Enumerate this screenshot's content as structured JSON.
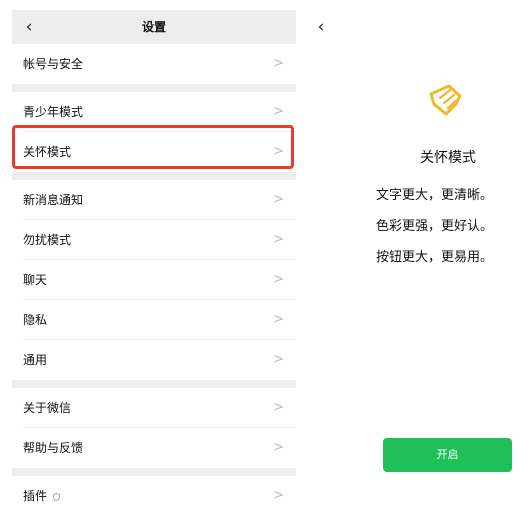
{
  "left": {
    "title": "设置",
    "rows": [
      {
        "label": "帐号与安全",
        "chevron": ">"
      },
      {
        "label": "青少年模式",
        "chevron": ">"
      },
      {
        "label": "关怀模式",
        "chevron": ">"
      },
      {
        "label": "新消息通知",
        "chevron": ">"
      },
      {
        "label": "勿扰模式",
        "chevron": ">"
      },
      {
        "label": "聊天",
        "chevron": ">"
      },
      {
        "label": "隐私",
        "chevron": ">"
      },
      {
        "label": "通用",
        "chevron": ">"
      },
      {
        "label": "关于微信",
        "chevron": ">"
      },
      {
        "label": "帮助与反馈",
        "chevron": ">"
      },
      {
        "label": "插件",
        "chevron": ">"
      }
    ]
  },
  "right": {
    "title": "关怀模式",
    "lines": [
      "文字更大，更清晰。",
      "色彩更强，更好认。",
      "按钮更大，更易用。"
    ],
    "button_label": "开启"
  },
  "icons": {
    "back": "back-arrow-icon",
    "chevron": "chevron-right-icon",
    "care": "care-mode-icon",
    "plugin": "shield-icon"
  },
  "colors": {
    "accent_green": "#1fc05a",
    "highlight_red": "#ea3a2f",
    "care_icon_yellow": "#f3b72b",
    "separator": "#ededed"
  }
}
